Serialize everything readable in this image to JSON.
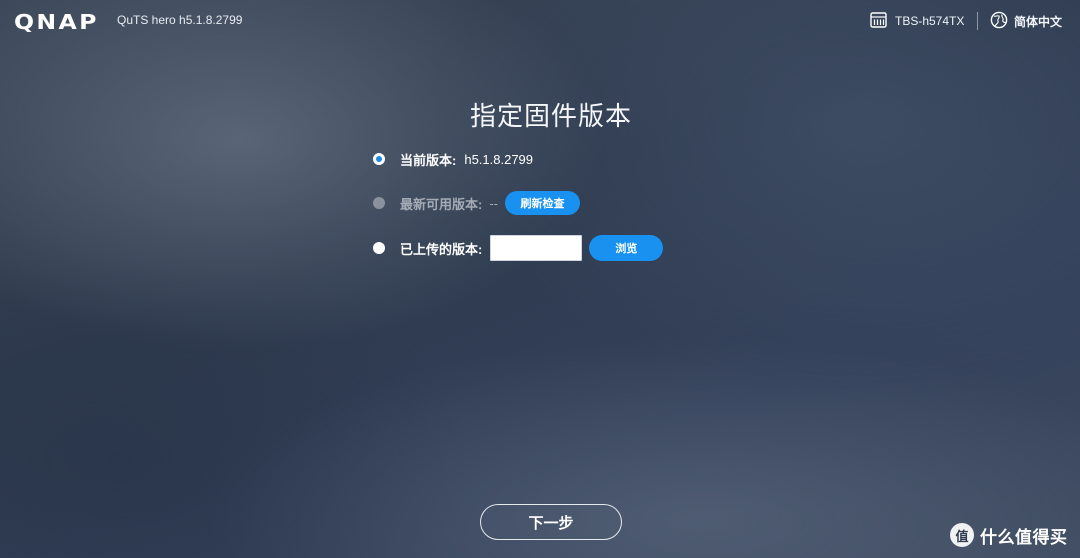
{
  "header": {
    "logo_text": "QNAP",
    "product_label": "QuTS hero h5.1.8.2799",
    "device_name": "TBS-h574TX",
    "language": "简体中文",
    "icons": {
      "device": "nas-device-icon",
      "language": "globe-icon"
    }
  },
  "main": {
    "title": "指定固件版本",
    "options": [
      {
        "label": "当前版本:",
        "value": "h5.1.8.2799",
        "state": "selected"
      },
      {
        "label": "最新可用版本:",
        "value": "--",
        "state": "disabled",
        "button": "刷新检查"
      },
      {
        "label": "已上传的版本:",
        "value": "",
        "state": "unselected",
        "button": "浏览"
      }
    ]
  },
  "footer": {
    "next_label": "下一步"
  },
  "watermark": {
    "text": "什么值得买",
    "badge_glyph": "值"
  },
  "colors": {
    "accent": "#1891f0",
    "background": "#33405a",
    "text": "#ffffff",
    "disabled_text": "#a4abb6"
  }
}
